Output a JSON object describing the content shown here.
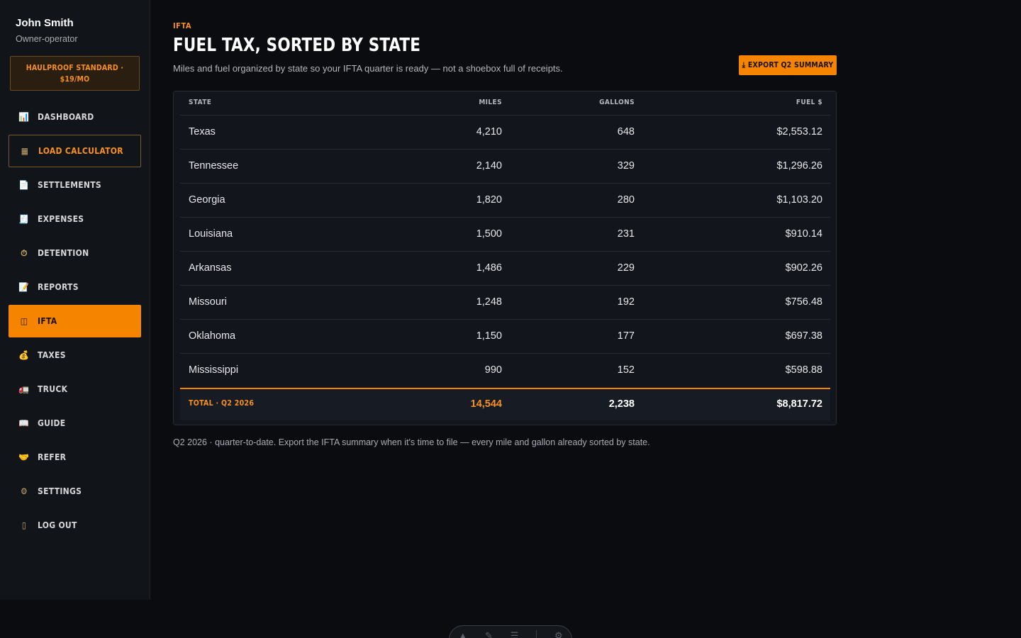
{
  "user": {
    "name": "John Smith",
    "role": "Owner-operator"
  },
  "plan": {
    "line1": "HAULPROOF STANDARD ·",
    "line2": "$19/MO"
  },
  "nav": [
    {
      "label": "DASHBOARD",
      "icon": "📊"
    },
    {
      "label": "LOAD CALCULATOR",
      "icon": "▦"
    },
    {
      "label": "SETTLEMENTS",
      "icon": "📄"
    },
    {
      "label": "EXPENSES",
      "icon": "🧾"
    },
    {
      "label": "DETENTION",
      "icon": "⏱"
    },
    {
      "label": "REPORTS",
      "icon": "📝"
    },
    {
      "label": "IFTA",
      "icon": "◫"
    },
    {
      "label": "TAXES",
      "icon": "💰"
    },
    {
      "label": "TRUCK",
      "icon": "🚛"
    },
    {
      "label": "GUIDE",
      "icon": "📖"
    },
    {
      "label": "REFER",
      "icon": "🤝"
    },
    {
      "label": "SETTINGS",
      "icon": "⚙"
    },
    {
      "label": "LOG OUT",
      "icon": "▯"
    }
  ],
  "header": {
    "eyebrow": "IFTA",
    "title": "FUEL TAX, SORTED BY STATE",
    "subtitle": "Miles and fuel organized by state so your IFTA quarter is ready — not a shoebox full of receipts.",
    "export_label": "⤓ EXPORT Q2 SUMMARY"
  },
  "table": {
    "columns": {
      "state": "STATE",
      "miles": "MILES",
      "gallons": "GALLONS",
      "fuel": "FUEL $"
    },
    "rows": [
      {
        "state": "Texas",
        "miles": "4,210",
        "gallons": "648",
        "fuel": "$2,553.12"
      },
      {
        "state": "Tennessee",
        "miles": "2,140",
        "gallons": "329",
        "fuel": "$1,296.26"
      },
      {
        "state": "Georgia",
        "miles": "1,820",
        "gallons": "280",
        "fuel": "$1,103.20"
      },
      {
        "state": "Louisiana",
        "miles": "1,500",
        "gallons": "231",
        "fuel": "$910.14"
      },
      {
        "state": "Arkansas",
        "miles": "1,486",
        "gallons": "229",
        "fuel": "$902.26"
      },
      {
        "state": "Missouri",
        "miles": "1,248",
        "gallons": "192",
        "fuel": "$756.48"
      },
      {
        "state": "Oklahoma",
        "miles": "1,150",
        "gallons": "177",
        "fuel": "$697.38"
      },
      {
        "state": "Mississippi",
        "miles": "990",
        "gallons": "152",
        "fuel": "$598.88"
      }
    ],
    "total": {
      "label": "TOTAL · Q2 2026",
      "miles": "14,544",
      "gallons": "2,238",
      "fuel": "$8,817.72"
    }
  },
  "footnote": "Q2 2026 · quarter-to-date. Export the IFTA summary when it's time to file — every mile and gallon already sorted by state.",
  "colors": {
    "accent": "#f58400",
    "background": "#0a0c10",
    "sidebar": "#111419"
  }
}
